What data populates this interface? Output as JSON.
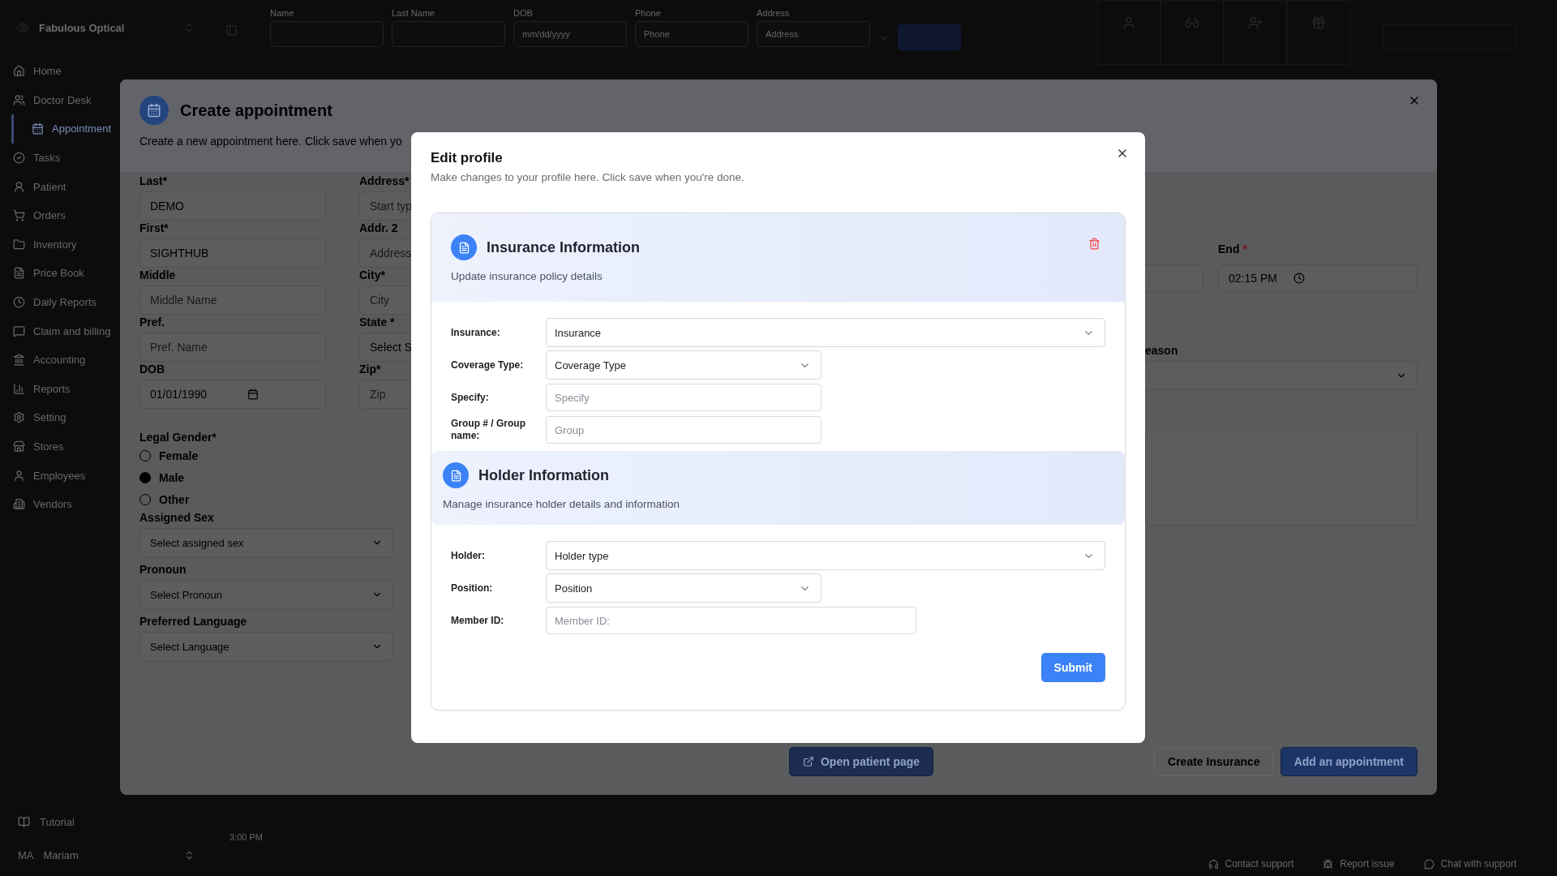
{
  "top_bar": {
    "brand": "Fabulous Optical",
    "search_fields": [
      {
        "label": "Name"
      },
      {
        "label": "Last Name"
      },
      {
        "label": "DOB",
        "placeholder": "mm/dd/yyyy"
      },
      {
        "label": "Phone",
        "placeholder": "Phone"
      },
      {
        "label": "Address",
        "placeholder": "Address"
      }
    ]
  },
  "sidebar": {
    "items": [
      {
        "label": "Home",
        "selected": false
      },
      {
        "label": "Doctor Desk",
        "selected": false
      },
      {
        "label": "Appointment",
        "selected": true
      },
      {
        "label": "Tasks",
        "selected": false
      },
      {
        "label": "Patient",
        "selected": false
      },
      {
        "label": "Orders",
        "selected": false
      },
      {
        "label": "Inventory",
        "selected": false
      },
      {
        "label": "Price Book",
        "selected": false
      },
      {
        "label": "Daily Reports",
        "selected": false
      },
      {
        "label": "Claim and billing",
        "selected": false
      },
      {
        "label": "Accounting",
        "selected": false
      },
      {
        "label": "Reports",
        "selected": false
      },
      {
        "label": "Setting",
        "selected": false
      },
      {
        "label": "Stores",
        "selected": false
      },
      {
        "label": "Employees",
        "selected": false
      },
      {
        "label": "Vendors",
        "selected": false
      }
    ],
    "tutorial": "Tutorial",
    "user": {
      "initials": "MA",
      "name": "Mariam"
    }
  },
  "background": {
    "time": "3:00 PM",
    "support_links": [
      "Contact support",
      "Report issue",
      "Chat with support"
    ]
  },
  "create_appointment": {
    "title": "Create appointment",
    "subtitle": "Create a new appointment here. Click save when yo",
    "name_fields": [
      {
        "label": "Last*",
        "kind": "input",
        "value": "DEMO"
      },
      {
        "label": "First*",
        "kind": "input",
        "value": "SIGHTHUB"
      },
      {
        "label": "Middle",
        "kind": "input",
        "placeholder": "Middle Name"
      },
      {
        "label": "Pref.",
        "kind": "input",
        "placeholder": "Pref. Name"
      },
      {
        "label": "DOB",
        "kind": "date",
        "value": "01/01/1990"
      }
    ],
    "address_fields": [
      {
        "label": "Address*",
        "kind": "input",
        "placeholder": "Start typ"
      },
      {
        "label": "Addr. 2",
        "kind": "input",
        "placeholder": "Address"
      },
      {
        "label": "City*",
        "kind": "input",
        "placeholder": "City"
      },
      {
        "label": "State *",
        "kind": "select",
        "value": "Select S"
      },
      {
        "label": "Zip*",
        "kind": "input",
        "placeholder": "Zip"
      }
    ],
    "legal_gender": {
      "label": "Legal Gender*",
      "options": [
        {
          "label": "Female",
          "selected": false
        },
        {
          "label": "Male",
          "selected": true
        },
        {
          "label": "Other",
          "selected": false
        }
      ]
    },
    "selects": [
      {
        "label": "Assigned Sex",
        "value": "Select assigned sex"
      },
      {
        "label": "Pronoun",
        "value": "Select Pronoun"
      },
      {
        "label": "Preferred Language",
        "value": "Select Language"
      }
    ],
    "end": {
      "label": "End",
      "required_mark": "*",
      "value": "02:15 PM"
    },
    "reason": {
      "label": "eason"
    },
    "buttons": [
      {
        "label": "Open patient page",
        "kind": "link"
      },
      {
        "label": "Create Insurance",
        "kind": "outline"
      },
      {
        "label": "Add an appointment",
        "kind": "primary"
      }
    ]
  },
  "edit_profile": {
    "title": "Edit profile",
    "subtitle": "Make changes to your profile here. Click save when you're done.",
    "sections": [
      {
        "title": "Insurance Information",
        "subtitle": "Update insurance policy details",
        "removable": true,
        "fields": [
          {
            "label": "Insurance:",
            "kind": "select",
            "value": "Insurance"
          },
          {
            "label": "Coverage Type:",
            "kind": "select",
            "value": "Coverage Type"
          },
          {
            "label": "Specify:",
            "kind": "input",
            "placeholder": "Specify"
          },
          {
            "label": "Group # / Group name:",
            "kind": "input",
            "placeholder": "Group"
          }
        ]
      },
      {
        "title": "Holder Information",
        "subtitle": "Manage insurance holder details and information",
        "removable": false,
        "fields": [
          {
            "label": "Holder:",
            "kind": "select",
            "value": "Holder type"
          },
          {
            "label": "Position:",
            "kind": "select",
            "value": "Position"
          },
          {
            "label": "Member ID:",
            "kind": "input",
            "placeholder": "Member ID:"
          }
        ]
      }
    ],
    "submit": "Submit"
  }
}
